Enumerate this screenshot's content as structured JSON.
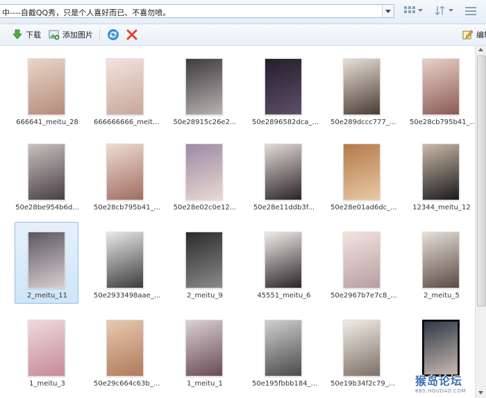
{
  "address": {
    "path": "中----自截QQ秀，只是个人喜好而已、不喜勿喷。"
  },
  "toolbar": {
    "download_label": "下载",
    "add_image_label": "添加图片",
    "edit_label": "编辑"
  },
  "files": [
    {
      "name": "666641_meitu_28",
      "c1": "#e8d6c8",
      "c2": "#b58b7a"
    },
    {
      "name": "666666666_meit...",
      "c1": "#f1e4dc",
      "c2": "#c9a79a"
    },
    {
      "name": "50e28915c26e2...",
      "c1": "#3c3b3f",
      "c2": "#b9b3b0"
    },
    {
      "name": "50e2896582dca_...",
      "c1": "#241f2b",
      "c2": "#5e4e6a"
    },
    {
      "name": "50e289dccc777_...",
      "c1": "#e8e0d6",
      "c2": "#4a3b34"
    },
    {
      "name": "50e28cb795b41_...",
      "c1": "#e9d0c8",
      "c2": "#8a5a55"
    },
    {
      "name": "50e28be954b6d...",
      "c1": "#c7c1bf",
      "c2": "#4b3f45"
    },
    {
      "name": "50e28cb795b41_...",
      "c1": "#eedbd2",
      "c2": "#a06e62"
    },
    {
      "name": "50e28e02c0e12...",
      "c1": "#9c8aa3",
      "c2": "#e7d9d4"
    },
    {
      "name": "50e28e11ddb3f...",
      "c1": "#e2dbd6",
      "c2": "#2b2328"
    },
    {
      "name": "50e28e01ad6dc_...",
      "c1": "#b37a48",
      "c2": "#e9c8a6"
    },
    {
      "name": "12344_meitu_12",
      "c1": "#c9b9a8",
      "c2": "#1c1a1b"
    },
    {
      "name": "2_meitu_11",
      "c1": "#5c5660",
      "c2": "#d6cfd1",
      "selected": true
    },
    {
      "name": "50e2933498aae_...",
      "c1": "#e8e8e8",
      "c2": "#3c3c3c"
    },
    {
      "name": "2_meitu_9",
      "c1": "#2b2b2b",
      "c2": "#8a8a8a"
    },
    {
      "name": "45551_meitu_6",
      "c1": "#f0ece8",
      "c2": "#2a2428"
    },
    {
      "name": "50e2967b7e7c8_...",
      "c1": "#f2e4e0",
      "c2": "#b79ea0"
    },
    {
      "name": "2_meitu_5",
      "c1": "#e7ded8",
      "c2": "#5b4a44"
    },
    {
      "name": "1_meitu_3",
      "c1": "#f0d9dc",
      "c2": "#c58a95"
    },
    {
      "name": "50e29c664c63b_...",
      "c1": "#e8c8b0",
      "c2": "#b07a5a"
    },
    {
      "name": "1_meitu_1",
      "c1": "#d9d0d3",
      "c2": "#6a4a55"
    },
    {
      "name": "50e195fbbb184_...",
      "c1": "#cfcfcf",
      "c2": "#4a4a4a"
    },
    {
      "name": "50e19b34f2c79_...",
      "c1": "#f2ede6",
      "c2": "#7c6f66"
    },
    {
      "name": "",
      "c1": "#2f3a4a",
      "c2": "#c9b8ae",
      "framed": true
    }
  ],
  "watermark": {
    "logo": "猴岛论坛",
    "url": "BBS.HOUDAO.COM"
  }
}
